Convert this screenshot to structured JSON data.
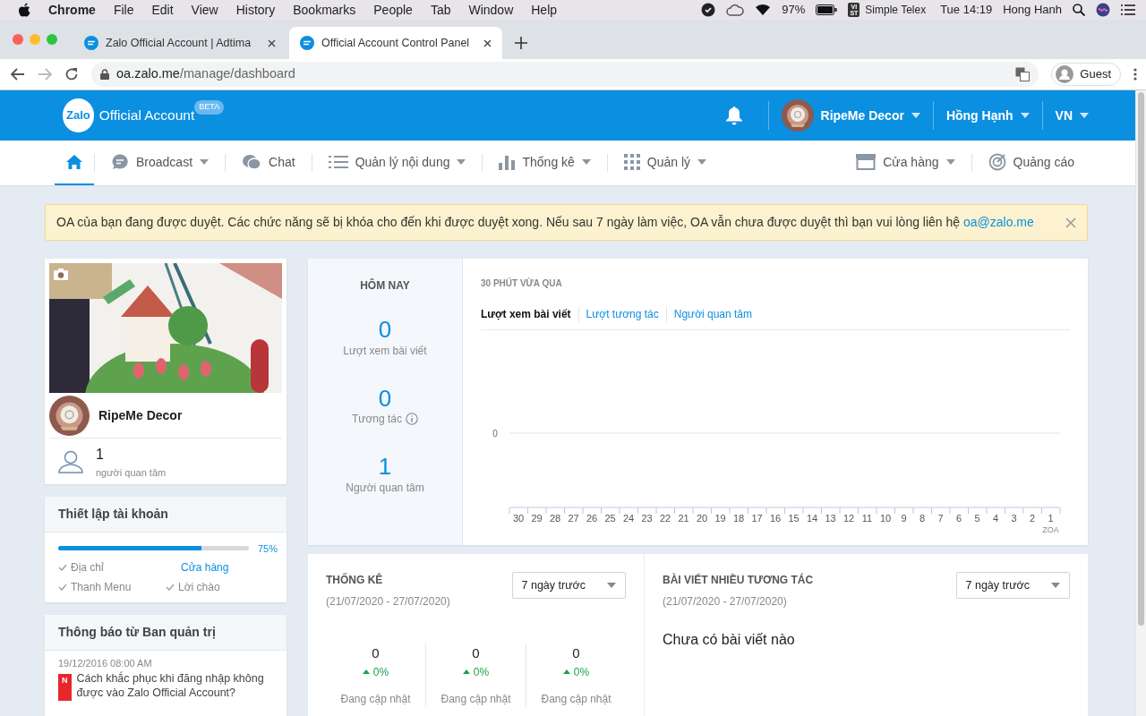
{
  "menubar": {
    "app": "Chrome",
    "menus": [
      "File",
      "Edit",
      "View",
      "History",
      "Bookmarks",
      "People",
      "Tab",
      "Window",
      "Help"
    ],
    "battery": "97%",
    "input_badge": [
      "VI",
      "ST"
    ],
    "input_source": "Simple Telex",
    "clock": "Tue 14:19",
    "user": "Hong Hanh"
  },
  "browser": {
    "tabs": [
      {
        "title": "Zalo Official Account | Adtima",
        "selected": false
      },
      {
        "title": "Official Account Control Panel",
        "selected": true
      }
    ],
    "url_host": "oa.zalo.me",
    "url_path": "/manage/dashboard",
    "profile": "Guest"
  },
  "header": {
    "logo": "Zalo",
    "product": "Official Account",
    "badge": "BETA",
    "page_name": "RipeMe Decor",
    "user": "Hồng Hạnh",
    "language": "VN"
  },
  "nav": {
    "items": [
      {
        "kind": "home",
        "selected": true
      },
      {
        "kind": "broadcast",
        "label": "Broadcast",
        "dropdown": true,
        "selected": false
      },
      {
        "kind": "chat",
        "label": "Chat",
        "dropdown": false,
        "selected": false
      },
      {
        "kind": "list",
        "label": "Quản lý nội dung",
        "dropdown": true,
        "selected": false
      },
      {
        "kind": "chart",
        "label": "Thống kê",
        "dropdown": true,
        "selected": false
      },
      {
        "kind": "grid",
        "label": "Quản lý",
        "dropdown": true,
        "selected": false
      }
    ],
    "right_items": [
      {
        "kind": "store",
        "label": "Cửa hàng",
        "dropdown": true,
        "selected": false
      },
      {
        "kind": "target",
        "label": "Quảng cáo",
        "dropdown": false,
        "selected": false
      }
    ]
  },
  "alert": {
    "text": "OA của bạn đang được duyệt. Các chức năng sẽ bị khóa cho đến khi được duyệt xong. Nếu sau 7 ngày làm việc, OA vẫn chưa được duyệt thì bạn vui lòng liên hệ",
    "link": "oa@zalo.me"
  },
  "profile": {
    "name": "RipeMe Decor",
    "followers": "1",
    "followers_label": "người quan tâm"
  },
  "setup": {
    "title": "Thiết lập tài khoản",
    "level": 0.75,
    "percent": "75%",
    "steps": [
      {
        "label": "Địa chỉ",
        "done": true
      },
      {
        "label": "Cửa hàng",
        "done": false
      },
      {
        "label": "Thanh Menu",
        "done": true
      },
      {
        "label": "Lời chào",
        "done": true
      }
    ]
  },
  "notices": {
    "title": "Thông báo từ Ban quản trị",
    "items": [
      {
        "date": "19/12/2016 08:00 AM",
        "badge": "N",
        "text": "Cách khắc phục khi đăng nhập không được vào Zalo Official Account?"
      }
    ]
  },
  "today": {
    "title": "HÔM NAY",
    "stats": [
      {
        "value": "0",
        "label": "Lượt xem bài viết",
        "info": false
      },
      {
        "value": "0",
        "label": "Tương tác",
        "info": true
      },
      {
        "value": "1",
        "label": "Người quan tâm",
        "info": false
      }
    ]
  },
  "recent": {
    "title": "30 PHÚT VỪA QUA",
    "zero_label": "0",
    "tabs": [
      {
        "label": "Lượt xem bài viết",
        "selected": true
      },
      {
        "label": "Lượt tương tác",
        "selected": false
      },
      {
        "label": "Người quan tâm",
        "selected": false
      }
    ],
    "axis_labels": [
      "30",
      "29",
      "28",
      "27",
      "26",
      "25",
      "24",
      "23",
      "22",
      "21",
      "20",
      "19",
      "18",
      "17",
      "16",
      "15",
      "14",
      "13",
      "12",
      "11",
      "10",
      "9",
      "8",
      "7",
      "6",
      "5",
      "4",
      "3",
      "2",
      "1"
    ],
    "axis_title": "ZOA"
  },
  "stats": {
    "title": "THỐNG KÊ",
    "range": "(21/07/2020 - 27/07/2020)",
    "select": "7 ngày trước",
    "metrics": [
      {
        "value": "0",
        "change": "0%",
        "label": "Đang cập nhật"
      },
      {
        "value": "0",
        "change": "0%",
        "label": "Đang cập nhật"
      },
      {
        "value": "0",
        "change": "0%",
        "label": "Đang cập nhật"
      }
    ]
  },
  "top_posts": {
    "title": "BÀI VIẾT NHIỀU TƯƠNG TÁC",
    "range": "(21/07/2020 - 27/07/2020)",
    "select": "7 ngày trước",
    "empty": "Chưa có bài viết nào"
  }
}
